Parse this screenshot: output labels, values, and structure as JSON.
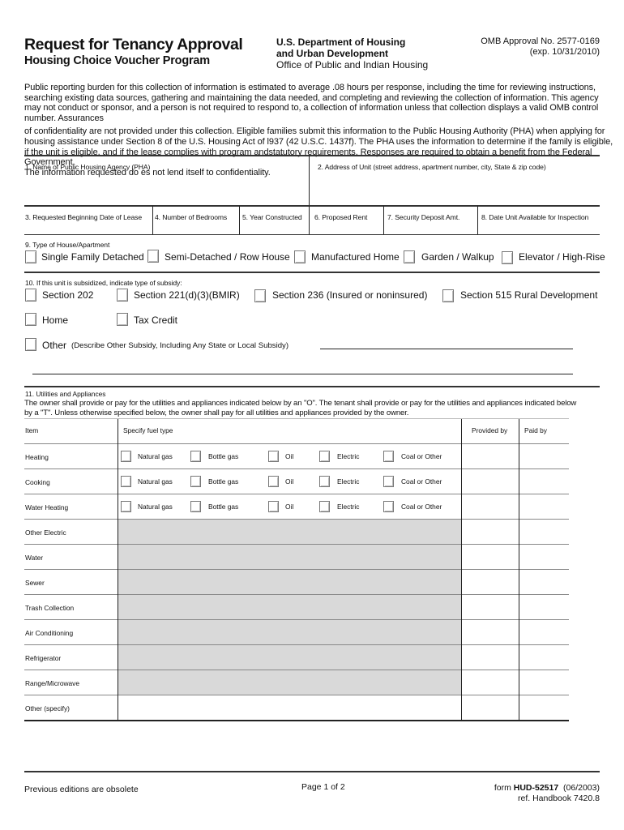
{
  "header": {
    "title": "Request for Tenancy Approval",
    "subtitle": "Housing Choice Voucher Program",
    "department_line1": "U.S. Department of Housing",
    "department_line2": "and Urban Development",
    "department_line3": "Office of Public and Indian Housing",
    "omb_approval": "OMB Approval No. 2577-0169",
    "omb_expiration": "(exp. 10/31/2010)"
  },
  "burden_statement": {
    "paragraph1": "Public reporting burden for this collection of information is estimated to average .08 hours per response, including the time for reviewing instructions, searching existing data sources, gathering and maintaining the data needed, and completing and reviewing the collection of information.  This agency may not conduct or sponsor, and a person is not required to respond to, a collection of information unless that collection displays a valid OMB control number.  Assurances",
    "paragraph2": "of confidentiality are not provided under this collection.  Eligible families submit this information to the Public Housing Authority (PHA) when applying for housing assistance under Section 8 of the U.S. Housing Act of l937 (42 U.S.C. 1437f). The PHA uses the information  to determine if the family is eligible, if the unit is eligible, and if the lease complies with program andstatutory requirements. Responses are required to obtain a benefit from the Federal Government.",
    "paragraph3": "The information requested do  es not lend itself to confidentiality."
  },
  "fields": {
    "pha_name": {
      "label": "1. Name of Public Housing Agency (PHA)",
      "value": ""
    },
    "unit_address": {
      "label": "2. Address of Unit  (street address, apartment number, city, State & zip code)",
      "value": ""
    },
    "lease_begin_date": {
      "label": "3. Requested Beginning Date of Lease",
      "value": ""
    },
    "bedrooms": {
      "label": "4.   Number of Bedrooms",
      "value": ""
    },
    "year_constructed": {
      "label": "5. Year Constructed",
      "value": ""
    },
    "proposed_rent": {
      "label": "6.  Proposed Rent",
      "value": ""
    },
    "security_deposit": {
      "label": "7.  Security Deposit Amt.",
      "value": ""
    },
    "inspection_date": {
      "label": "8. Date Unit Available for Inspection",
      "value": ""
    }
  },
  "house_type": {
    "label": "9.  Type of House/Apartment",
    "options": [
      {
        "label": "Single Family Detached",
        "checked": false
      },
      {
        "label": "Semi-Detached / Row House",
        "checked": false
      },
      {
        "label": "Manufactured Home",
        "checked": false
      },
      {
        "label": "Garden / Walkup",
        "checked": false
      },
      {
        "label": "Elevator / High-Rise",
        "checked": false
      }
    ]
  },
  "subsidy": {
    "label": "10. If this unit is subsidized, indicate type of subsidy:",
    "options": [
      {
        "label": "Section 202",
        "checked": false
      },
      {
        "label": "Section 221(d)(3)(BMIR)",
        "checked": false
      },
      {
        "label": "Section 236 (Insured or noninsured)",
        "checked": false
      },
      {
        "label": "Section 515 Rural Development",
        "checked": false
      },
      {
        "label": "Home",
        "checked": false
      },
      {
        "label": "Tax Credit",
        "checked": false
      }
    ],
    "other_label": "Other",
    "other_description": "(Describe Other Subsidy, Including Any State or Local Subsidy)",
    "other_value": ""
  },
  "utilities": {
    "label": "11. Utilities and Appliances",
    "instructions_line1": "The owner shall provide or pay for the utilities and appliances indicated below by an \"O\".  The tenant shall provide or pay for the utilities and appliances indicated below",
    "instructions_line2": "by a \"T\".  Unless otherwise specified below, the owner shall pay for all utilities and appliances provided by the owner.",
    "columns": [
      "Item",
      "Specify fuel type",
      "Provided by",
      "Paid by"
    ],
    "fuel_types": [
      "Natural gas",
      "Bottle gas",
      "Oil",
      "Electric",
      "Coal or Other"
    ],
    "rows": [
      {
        "item": "Heating",
        "has_fuel": true,
        "provided_by": "",
        "paid_by": ""
      },
      {
        "item": "Cooking",
        "has_fuel": true,
        "provided_by": "",
        "paid_by": ""
      },
      {
        "item": "Water Heating",
        "has_fuel": true,
        "provided_by": "",
        "paid_by": ""
      },
      {
        "item": "Other Electric",
        "has_fuel": false,
        "provided_by": "",
        "paid_by": ""
      },
      {
        "item": "Water",
        "has_fuel": false,
        "provided_by": "",
        "paid_by": ""
      },
      {
        "item": "Sewer",
        "has_fuel": false,
        "provided_by": "",
        "paid_by": ""
      },
      {
        "item": "Trash Collection",
        "has_fuel": false,
        "provided_by": "",
        "paid_by": ""
      },
      {
        "item": "Air Conditioning",
        "has_fuel": false,
        "provided_by": "",
        "paid_by": ""
      },
      {
        "item": "Refrigerator",
        "has_fuel": false,
        "provided_by": "",
        "paid_by": ""
      },
      {
        "item": "Range/Microwave",
        "has_fuel": false,
        "provided_by": "",
        "paid_by": ""
      },
      {
        "item": "Other (specify)",
        "has_fuel": false,
        "provided_by": "",
        "paid_by": ""
      }
    ]
  },
  "footer": {
    "left": "Previous editions are obsolete",
    "page": "Page 1 of 2",
    "form_prefix": "form ",
    "form_number": "HUD-52517",
    "form_date": "  (06/2003)",
    "handbook": "ref. Handbook 7420.8"
  }
}
